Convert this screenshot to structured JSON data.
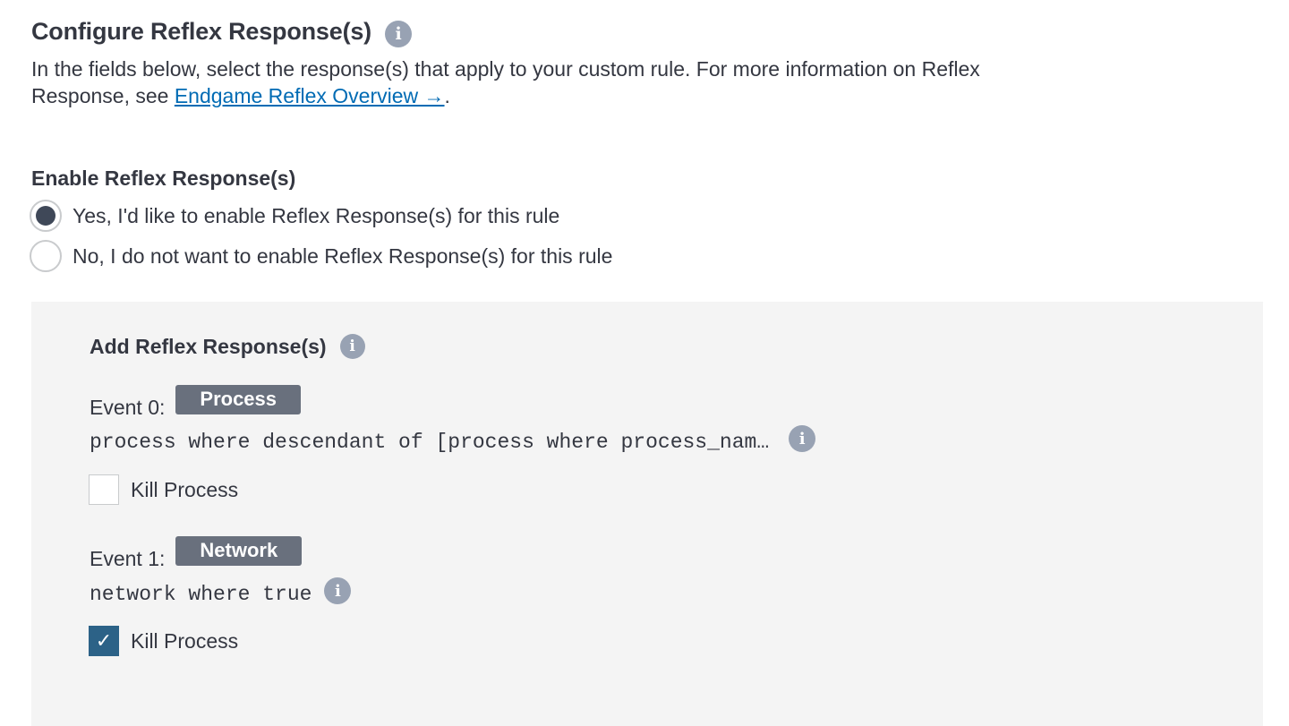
{
  "configure": {
    "title": "Configure Reflex Response(s)",
    "description_prefix": "In the fields below, select the response(s) that apply to your custom rule. For more information on Reflex Response, see ",
    "link_text": "Endgame Reflex Overview →",
    "description_suffix": "."
  },
  "enable": {
    "title": "Enable Reflex Response(s)",
    "options": [
      {
        "label": "Yes, I'd like to enable Reflex Response(s) for this rule",
        "selected": true
      },
      {
        "label": "No, I do not want to enable Reflex Response(s) for this rule",
        "selected": false
      }
    ]
  },
  "panel": {
    "title": "Add Reflex Response(s)",
    "events": [
      {
        "label": "Event 0:",
        "badge": "Process",
        "query": "process where descendant of [process where process_nam…",
        "action_label": "Kill Process",
        "checked": false
      },
      {
        "label": "Event 1:",
        "badge": "Network",
        "query": "network where true",
        "action_label": "Kill Process",
        "checked": true
      }
    ]
  },
  "icons": {
    "info": "info-icon",
    "check": "checkmark-icon"
  },
  "colors": {
    "link": "#006bb4",
    "badge_bg": "#69707d",
    "checkbox_checked": "#2c6287",
    "panel_bg": "#f4f4f4",
    "info_icon": "#98a2b3"
  }
}
